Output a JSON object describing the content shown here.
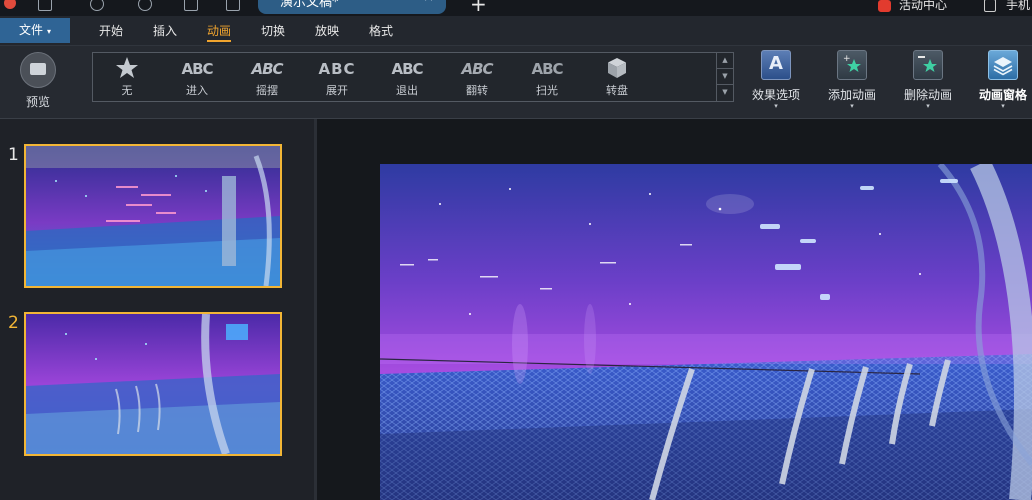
{
  "titlebar": {
    "doc_tab": "演示文稿*",
    "close_glyph": "×",
    "new_tab_glyph": "+",
    "event_center": "活动中心",
    "phone_label": "手机"
  },
  "menu": {
    "file": "文件",
    "caret": "▾",
    "items": [
      "开始",
      "插入",
      "动画",
      "切换",
      "放映",
      "格式"
    ],
    "active": "动画"
  },
  "ribbon": {
    "preview": "预览",
    "gallery": [
      {
        "label": "无",
        "icon": "star-icon"
      },
      {
        "label": "进入",
        "icon": "abc-enter-icon",
        "glyph": "ABC"
      },
      {
        "label": "摇摆",
        "icon": "abc-swing-icon",
        "glyph": "ABC"
      },
      {
        "label": "展开",
        "icon": "abc-expand-icon",
        "glyph": "ABC"
      },
      {
        "label": "退出",
        "icon": "abc-exit-icon",
        "glyph": "ABC"
      },
      {
        "label": "翻转",
        "icon": "abc-flip-icon",
        "glyph": "ABC"
      },
      {
        "label": "扫光",
        "icon": "abc-sweep-icon",
        "glyph": "ABC"
      },
      {
        "label": "转盘",
        "icon": "turntable-icon"
      }
    ],
    "gallery_scroll": {
      "up": "▲",
      "down": "▼",
      "more": "▼"
    },
    "effect_options": "效果选项",
    "effect_options_glyph": "A",
    "add_animation": "添加动画",
    "remove_animation": "删除动画",
    "animation_pane": "动画窗格",
    "caret": "▾"
  },
  "slides": [
    {
      "number": "1"
    },
    {
      "number": "2"
    }
  ],
  "colors": {
    "accent": "#f0a42e",
    "thumb_border": "#f2b636",
    "file_button": "#2f6495"
  }
}
